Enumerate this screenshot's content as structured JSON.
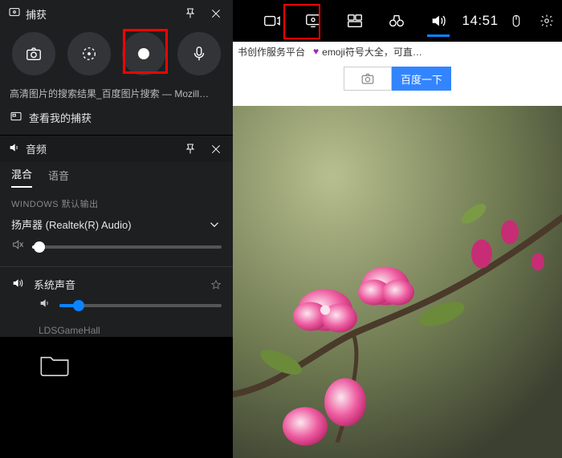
{
  "topbar": {
    "clock": "14:51"
  },
  "overlay": {
    "capture_header": "捕获",
    "page_title": "高清图片的搜索结果_百度图片搜索 — Mozill…",
    "view_captures": "查看我的捕获",
    "audio_header": "音频",
    "tabs": {
      "mix": "混合",
      "voice": "语音"
    },
    "output_section_label": "WINDOWS 默认输出",
    "device_name": "扬声器 (Realtek(R) Audio)",
    "device_volume_pct": 4,
    "source1_name": "系统声音",
    "source1_volume_pct": 12,
    "source2_name": "LDSGameHall"
  },
  "browser": {
    "bm1": "书创作服务平台",
    "bm2": "emoji符号大全，可直…",
    "search_button_label": "百度一下"
  }
}
